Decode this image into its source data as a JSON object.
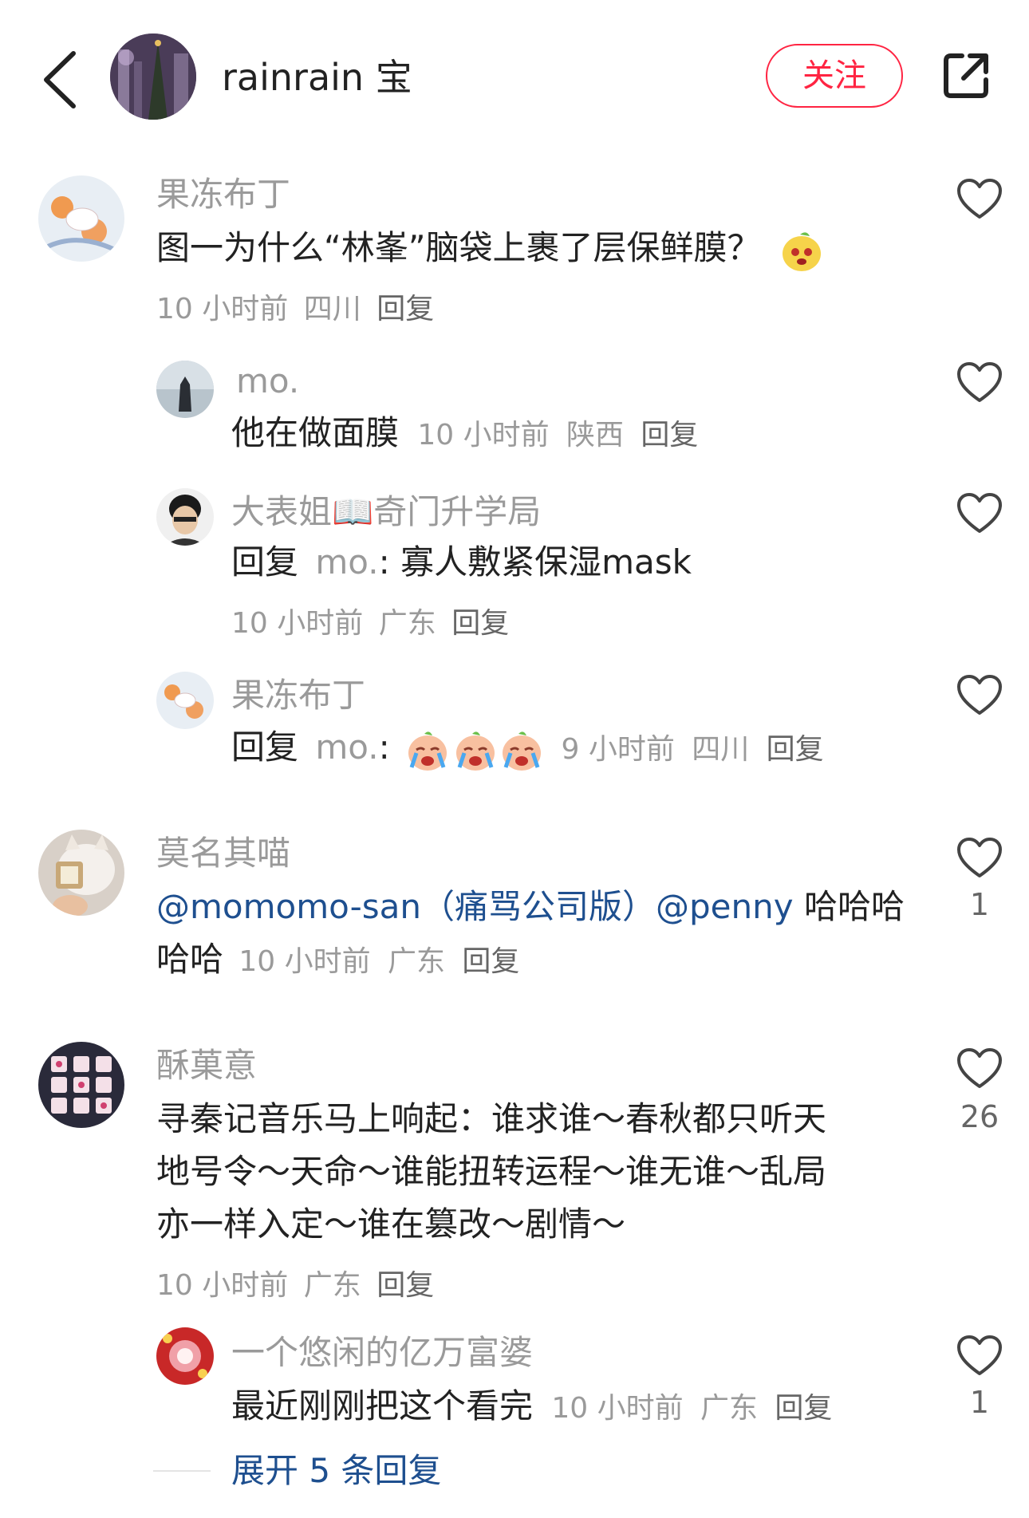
{
  "header": {
    "author_name": "rainrain 宝",
    "follow_label": "关注",
    "back_icon": "chevron-left-icon",
    "share_icon": "share-icon"
  },
  "comments": [
    {
      "user": "果冻布丁",
      "text": "图一为什么“林峯”脑袋上裹了层保鲜膜？",
      "time": "10 小时前",
      "location": "四川",
      "reply_label": "回复"
    },
    {
      "user": "mo.",
      "text": "他在做面膜",
      "time": "10 小时前",
      "location": "陕西",
      "reply_label": "回复"
    },
    {
      "user": "大表姐📖奇门升学局",
      "reply_prefix": "回复",
      "reply_to": "mo.",
      "text": ": 寡人敷紧保湿mask",
      "time": "10 小时前",
      "location": "广东",
      "reply_label": "回复"
    },
    {
      "user": "果冻布丁",
      "reply_prefix": "回复",
      "reply_to": "mo.",
      "text": ":",
      "time": "9 小时前",
      "location": "四川",
      "reply_label": "回复"
    },
    {
      "user": "莫名其喵",
      "mention": "@momomo-san（痛骂公司版）@penny",
      "text": " 哈哈哈",
      "text2": "哈哈",
      "time": "10 小时前",
      "location": "广东",
      "reply_label": "回复",
      "likes": "1"
    },
    {
      "user": "酥菓意",
      "line1": "寻秦记音乐马上响起：谁求谁～春秋都只听天",
      "line2": "地号令～天命～谁能扭转运程～谁无谁～乱局",
      "line3": "亦一样入定～谁在篡改～剧情～",
      "time": "10 小时前",
      "location": "广东",
      "reply_label": "回复",
      "likes": "26"
    },
    {
      "user": "一个悠闲的亿万富婆",
      "text": "最近刚刚把这个看完",
      "time": "10 小时前",
      "location": "广东",
      "reply_label": "回复",
      "likes": "1"
    }
  ],
  "expand_label": "展开 5 条回复",
  "colors": {
    "accent": "#ff2442",
    "link": "#1e4f8f",
    "muted": "#9a9a9a"
  }
}
